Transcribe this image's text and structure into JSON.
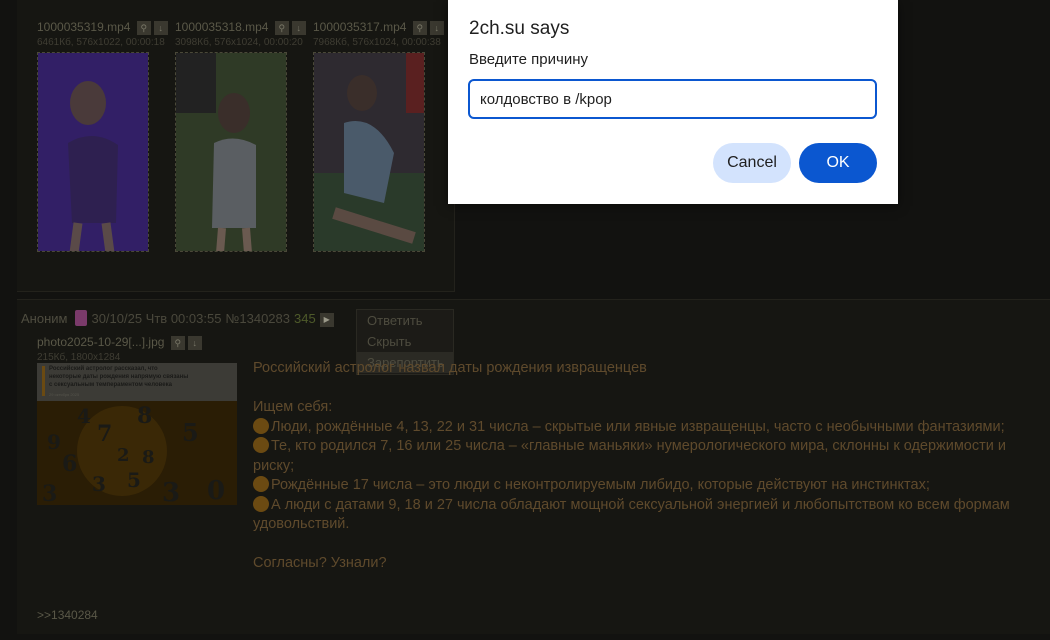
{
  "thread": {
    "files_row": [
      {
        "name": "1000035319.mp4",
        "meta": "6461Кб, 576x1022, 00:00:18"
      },
      {
        "name": "1000035318.mp4",
        "meta": "3098Кб, 576x1024, 00:00:20"
      },
      {
        "name": "1000035317.mp4",
        "meta": "7968Кб, 576x1024, 00:00:38"
      }
    ],
    "file_tool_icons": [
      "magnifier-icon",
      "download-icon"
    ]
  },
  "post": {
    "author": "Аноним",
    "datetime": "30/10/25 Чтв 00:03:55",
    "number": "№1340283",
    "reply_count": "345",
    "play_glyph": "▶",
    "file": {
      "name": "photo2025-10-29[...].jpg",
      "meta": "215Кб, 1800x1284"
    },
    "thumb": {
      "headline_1": "Российский астролог рассказал, что",
      "headline_2": "некоторые даты рождения напрямую связаны",
      "headline_3": "с сексуальным темпераментом человека",
      "date": "29 октября 2025"
    },
    "body": {
      "title": "Российский астролог назвал даты рождения извращенцев",
      "intro": "Ищем себя:",
      "items": [
        "Люди, рождённые 4, 13, 22 и 31 числа – скрытые или явные извращенцы, часто с необычными фантазиями;",
        "Те, кто родился 7, 16 или 25 числа – «главные маньяки» нумерологического мира, склонны к одержимости и риску;",
        "Рождённые 17 числа – это люди с неконтролируемым либидо, которые действуют на инстинктах;",
        "А люди с датами 9, 18 и 27 числа обладают мощной сексуальной энергией и любопытством ко всем формам удовольствий."
      ],
      "outro": "Согласны? Узнали?"
    },
    "reply_link": ">>1340284"
  },
  "context_menu": {
    "items": [
      "Ответить",
      "Скрыть",
      "Зарепортить"
    ],
    "highlighted": "Зарепортить"
  },
  "dialog": {
    "title": "2ch.su says",
    "message": "Введите причину",
    "input_value": "колдовство в /kpop",
    "cancel_label": "Cancel",
    "ok_label": "OK",
    "accent_color": "#0b57d0",
    "cancel_color": "#d3e3fd"
  }
}
